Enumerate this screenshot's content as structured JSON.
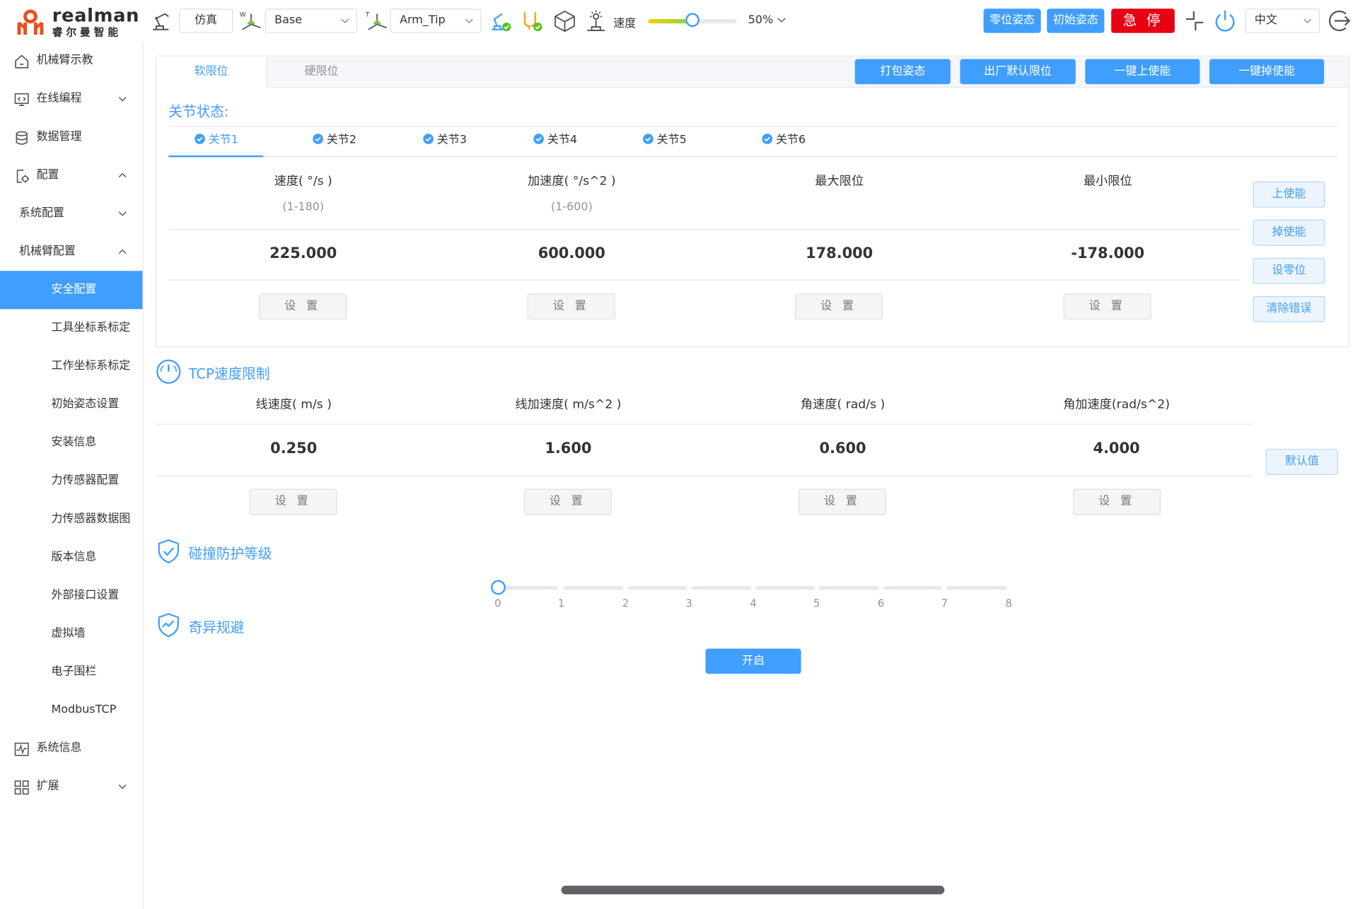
{
  "header": {
    "logo_en": "realman",
    "logo_cn": "睿尔曼智能",
    "mode_label": "仿真",
    "frame_select": "Base",
    "tool_select": "Arm_Tip",
    "speed_label": "速度",
    "speed_value": "50%",
    "speed_fraction": 0.5,
    "btn_zero_pose": "零位姿态",
    "btn_init_pose": "初始姿态",
    "btn_estop": "急 停",
    "language": "中文",
    "colors": {
      "primary": "#409eff",
      "estop": "#e60012"
    }
  },
  "sidebar": {
    "items": [
      {
        "label": "机械臂示教",
        "icon": "home-icon"
      },
      {
        "label": "在线编程",
        "icon": "code-icon",
        "expand": "down"
      },
      {
        "label": "数据管理",
        "icon": "database-icon"
      },
      {
        "label": "配置",
        "icon": "config-icon",
        "expand": "up"
      },
      {
        "label": "系统配置",
        "expand": "down"
      },
      {
        "label": "机械臂配置",
        "expand": "up"
      },
      {
        "label": "安全配置"
      },
      {
        "label": "工具坐标系标定"
      },
      {
        "label": "工作坐标系标定"
      },
      {
        "label": "初始姿态设置"
      },
      {
        "label": "安装信息"
      },
      {
        "label": "力传感器配置"
      },
      {
        "label": "力传感器数据图"
      },
      {
        "label": "版本信息"
      },
      {
        "label": "外部接口设置"
      },
      {
        "label": "虚拟墙"
      },
      {
        "label": "电子围栏"
      },
      {
        "label": "ModbusTCP"
      },
      {
        "label": "系统信息",
        "icon": "monitor-icon"
      },
      {
        "label": "扩展",
        "icon": "grid-icon",
        "expand": "down"
      }
    ]
  },
  "main": {
    "tabs": [
      "软限位",
      "硬限位"
    ],
    "actions": [
      "打包姿态",
      "出厂默认限位",
      "一键上使能",
      "一键掉使能"
    ],
    "joint_state_title": "关节状态:",
    "joints": [
      "关节1",
      "关节2",
      "关节3",
      "关节4",
      "关节5",
      "关节6"
    ],
    "joint_table": {
      "headers": [
        "速度( °/s )",
        "加速度( °/s^2 )",
        "最大限位",
        "最小限位"
      ],
      "ranges": [
        "(1-180)",
        "(1-600)"
      ],
      "values": [
        "225.000",
        "600.000",
        "178.000",
        "-178.000"
      ],
      "set_label": "设 置"
    },
    "joint_side_buttons": [
      "上使能",
      "掉使能",
      "设零位",
      "清除错误"
    ],
    "tcp": {
      "title": "TCP速度限制",
      "headers": [
        "线速度( m/s )",
        "线加速度( m/s^2 )",
        "角速度( rad/s )",
        "角加速度(rad/s^2)"
      ],
      "values": [
        "0.250",
        "1.600",
        "0.600",
        "4.000"
      ],
      "set_label": "设 置",
      "default_button": "默认值"
    },
    "collision": {
      "title": "碰撞防护等级",
      "ticks": [
        "0",
        "1",
        "2",
        "3",
        "4",
        "5",
        "6",
        "7",
        "8"
      ],
      "value": 0
    },
    "singularity": {
      "title": "奇异规避",
      "button": "开启"
    }
  }
}
